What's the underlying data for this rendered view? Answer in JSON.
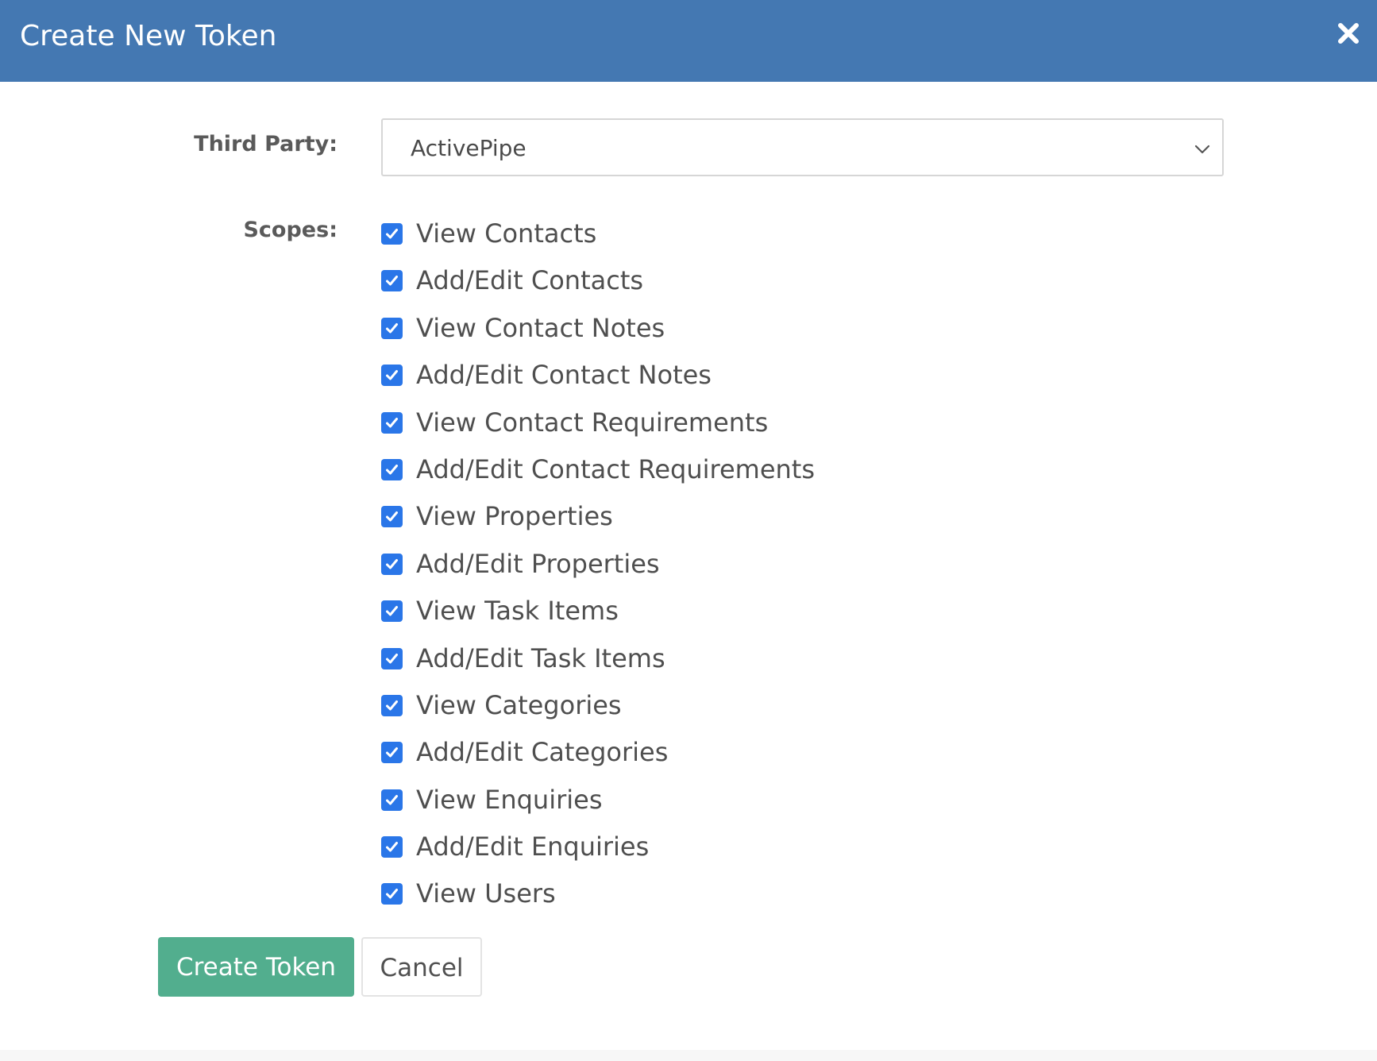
{
  "header": {
    "title": "Create New Token",
    "close_icon": "close-x-icon",
    "background_color": "#4478b2"
  },
  "form": {
    "third_party_label": "Third Party:",
    "third_party_value": "ActivePipe",
    "scopes_label": "Scopes:",
    "scopes": [
      {
        "label": "View Contacts",
        "checked": true
      },
      {
        "label": "Add/Edit Contacts",
        "checked": true
      },
      {
        "label": "View Contact Notes",
        "checked": true
      },
      {
        "label": "Add/Edit Contact Notes",
        "checked": true
      },
      {
        "label": "View Contact Requirements",
        "checked": true
      },
      {
        "label": "Add/Edit Contact Requirements",
        "checked": true
      },
      {
        "label": "View Properties",
        "checked": true
      },
      {
        "label": "Add/Edit Properties",
        "checked": true
      },
      {
        "label": "View Task Items",
        "checked": true
      },
      {
        "label": "Add/Edit Task Items",
        "checked": true
      },
      {
        "label": "View Categories",
        "checked": true
      },
      {
        "label": "Add/Edit Categories",
        "checked": true
      },
      {
        "label": "View Enquiries",
        "checked": true
      },
      {
        "label": "Add/Edit Enquiries",
        "checked": true
      },
      {
        "label": "View Users",
        "checked": true
      }
    ],
    "checkbox_color": "#2a76e8"
  },
  "actions": {
    "create_label": "Create Token",
    "cancel_label": "Cancel",
    "create_color": "#52ae8e"
  }
}
